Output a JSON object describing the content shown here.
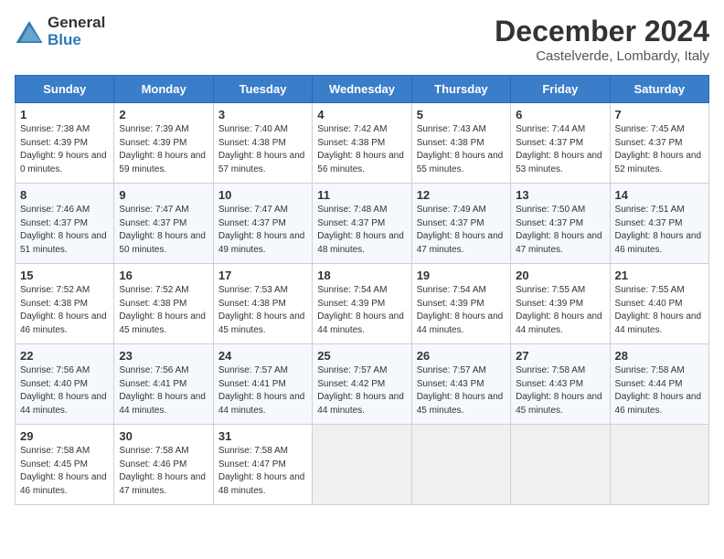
{
  "logo": {
    "general": "General",
    "blue": "Blue"
  },
  "title": "December 2024",
  "location": "Castelverde, Lombardy, Italy",
  "days_of_week": [
    "Sunday",
    "Monday",
    "Tuesday",
    "Wednesday",
    "Thursday",
    "Friday",
    "Saturday"
  ],
  "weeks": [
    [
      {
        "day": "1",
        "sunrise": "Sunrise: 7:38 AM",
        "sunset": "Sunset: 4:39 PM",
        "daylight": "Daylight: 9 hours and 0 minutes."
      },
      {
        "day": "2",
        "sunrise": "Sunrise: 7:39 AM",
        "sunset": "Sunset: 4:39 PM",
        "daylight": "Daylight: 8 hours and 59 minutes."
      },
      {
        "day": "3",
        "sunrise": "Sunrise: 7:40 AM",
        "sunset": "Sunset: 4:38 PM",
        "daylight": "Daylight: 8 hours and 57 minutes."
      },
      {
        "day": "4",
        "sunrise": "Sunrise: 7:42 AM",
        "sunset": "Sunset: 4:38 PM",
        "daylight": "Daylight: 8 hours and 56 minutes."
      },
      {
        "day": "5",
        "sunrise": "Sunrise: 7:43 AM",
        "sunset": "Sunset: 4:38 PM",
        "daylight": "Daylight: 8 hours and 55 minutes."
      },
      {
        "day": "6",
        "sunrise": "Sunrise: 7:44 AM",
        "sunset": "Sunset: 4:37 PM",
        "daylight": "Daylight: 8 hours and 53 minutes."
      },
      {
        "day": "7",
        "sunrise": "Sunrise: 7:45 AM",
        "sunset": "Sunset: 4:37 PM",
        "daylight": "Daylight: 8 hours and 52 minutes."
      }
    ],
    [
      {
        "day": "8",
        "sunrise": "Sunrise: 7:46 AM",
        "sunset": "Sunset: 4:37 PM",
        "daylight": "Daylight: 8 hours and 51 minutes."
      },
      {
        "day": "9",
        "sunrise": "Sunrise: 7:47 AM",
        "sunset": "Sunset: 4:37 PM",
        "daylight": "Daylight: 8 hours and 50 minutes."
      },
      {
        "day": "10",
        "sunrise": "Sunrise: 7:47 AM",
        "sunset": "Sunset: 4:37 PM",
        "daylight": "Daylight: 8 hours and 49 minutes."
      },
      {
        "day": "11",
        "sunrise": "Sunrise: 7:48 AM",
        "sunset": "Sunset: 4:37 PM",
        "daylight": "Daylight: 8 hours and 48 minutes."
      },
      {
        "day": "12",
        "sunrise": "Sunrise: 7:49 AM",
        "sunset": "Sunset: 4:37 PM",
        "daylight": "Daylight: 8 hours and 47 minutes."
      },
      {
        "day": "13",
        "sunrise": "Sunrise: 7:50 AM",
        "sunset": "Sunset: 4:37 PM",
        "daylight": "Daylight: 8 hours and 47 minutes."
      },
      {
        "day": "14",
        "sunrise": "Sunrise: 7:51 AM",
        "sunset": "Sunset: 4:37 PM",
        "daylight": "Daylight: 8 hours and 46 minutes."
      }
    ],
    [
      {
        "day": "15",
        "sunrise": "Sunrise: 7:52 AM",
        "sunset": "Sunset: 4:38 PM",
        "daylight": "Daylight: 8 hours and 46 minutes."
      },
      {
        "day": "16",
        "sunrise": "Sunrise: 7:52 AM",
        "sunset": "Sunset: 4:38 PM",
        "daylight": "Daylight: 8 hours and 45 minutes."
      },
      {
        "day": "17",
        "sunrise": "Sunrise: 7:53 AM",
        "sunset": "Sunset: 4:38 PM",
        "daylight": "Daylight: 8 hours and 45 minutes."
      },
      {
        "day": "18",
        "sunrise": "Sunrise: 7:54 AM",
        "sunset": "Sunset: 4:39 PM",
        "daylight": "Daylight: 8 hours and 44 minutes."
      },
      {
        "day": "19",
        "sunrise": "Sunrise: 7:54 AM",
        "sunset": "Sunset: 4:39 PM",
        "daylight": "Daylight: 8 hours and 44 minutes."
      },
      {
        "day": "20",
        "sunrise": "Sunrise: 7:55 AM",
        "sunset": "Sunset: 4:39 PM",
        "daylight": "Daylight: 8 hours and 44 minutes."
      },
      {
        "day": "21",
        "sunrise": "Sunrise: 7:55 AM",
        "sunset": "Sunset: 4:40 PM",
        "daylight": "Daylight: 8 hours and 44 minutes."
      }
    ],
    [
      {
        "day": "22",
        "sunrise": "Sunrise: 7:56 AM",
        "sunset": "Sunset: 4:40 PM",
        "daylight": "Daylight: 8 hours and 44 minutes."
      },
      {
        "day": "23",
        "sunrise": "Sunrise: 7:56 AM",
        "sunset": "Sunset: 4:41 PM",
        "daylight": "Daylight: 8 hours and 44 minutes."
      },
      {
        "day": "24",
        "sunrise": "Sunrise: 7:57 AM",
        "sunset": "Sunset: 4:41 PM",
        "daylight": "Daylight: 8 hours and 44 minutes."
      },
      {
        "day": "25",
        "sunrise": "Sunrise: 7:57 AM",
        "sunset": "Sunset: 4:42 PM",
        "daylight": "Daylight: 8 hours and 44 minutes."
      },
      {
        "day": "26",
        "sunrise": "Sunrise: 7:57 AM",
        "sunset": "Sunset: 4:43 PM",
        "daylight": "Daylight: 8 hours and 45 minutes."
      },
      {
        "day": "27",
        "sunrise": "Sunrise: 7:58 AM",
        "sunset": "Sunset: 4:43 PM",
        "daylight": "Daylight: 8 hours and 45 minutes."
      },
      {
        "day": "28",
        "sunrise": "Sunrise: 7:58 AM",
        "sunset": "Sunset: 4:44 PM",
        "daylight": "Daylight: 8 hours and 46 minutes."
      }
    ],
    [
      {
        "day": "29",
        "sunrise": "Sunrise: 7:58 AM",
        "sunset": "Sunset: 4:45 PM",
        "daylight": "Daylight: 8 hours and 46 minutes."
      },
      {
        "day": "30",
        "sunrise": "Sunrise: 7:58 AM",
        "sunset": "Sunset: 4:46 PM",
        "daylight": "Daylight: 8 hours and 47 minutes."
      },
      {
        "day": "31",
        "sunrise": "Sunrise: 7:58 AM",
        "sunset": "Sunset: 4:47 PM",
        "daylight": "Daylight: 8 hours and 48 minutes."
      },
      null,
      null,
      null,
      null
    ]
  ]
}
